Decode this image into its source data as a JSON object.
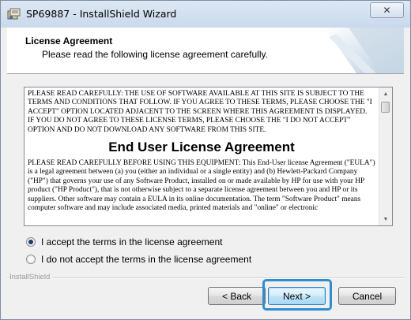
{
  "window": {
    "title": "SP69887 - InstallShield Wizard",
    "close_glyph": "✕"
  },
  "header": {
    "title": "License Agreement",
    "subtitle": "Please read the following license agreement carefully."
  },
  "license": {
    "paragraph1": "PLEASE READ CAREFULLY: THE USE OF SOFTWARE AVAILABLE AT THIS SITE IS SUBJECT TO THE TERMS AND CONDITIONS THAT FOLLOW. IF YOU AGREE TO THESE TERMS, PLEASE CHOOSE THE \"I ACCEPT\" OPTION LOCATED ADJACENT TO THE SCREEN WHERE THIS AGREEMENT IS DISPLAYED. IF YOU DO NOT AGREE TO THESE LICENSE TERMS, PLEASE CHOOSE THE \"I DO NOT ACCEPT\" OPTION AND DO NOT DOWNLOAD ANY SOFTWARE FROM THIS SITE.",
    "heading": "End User License Agreement",
    "paragraph2": "PLEASE READ CAREFULLY BEFORE USING THIS EQUIPMENT: This End-User license Agreement (\"EULA\") is a legal agreement between (a) you (either an individual or a single entity) and (b) Hewlett-Packard Company (\"HP\") that governs your use of any Software Product, installed on or made available by HP for use with your HP product (\"HP Product\"), that is not otherwise subject to a separate license agreement between you and HP or its suppliers. Other software may contain a EULA in its online documentation. The term \"Software Product\" means computer software and may include associated media, printed materials and \"online\" or electronic"
  },
  "options": {
    "accept_label": "I accept the terms in the license agreement",
    "decline_label": "I do not accept the terms in the license agreement",
    "selected": "accept"
  },
  "brand": "InstallShield",
  "buttons": {
    "back": "< Back",
    "next": "Next >",
    "cancel": "Cancel"
  },
  "colors": {
    "highlight": "#2d8fd2",
    "titlebar": "#c9d9ec"
  }
}
